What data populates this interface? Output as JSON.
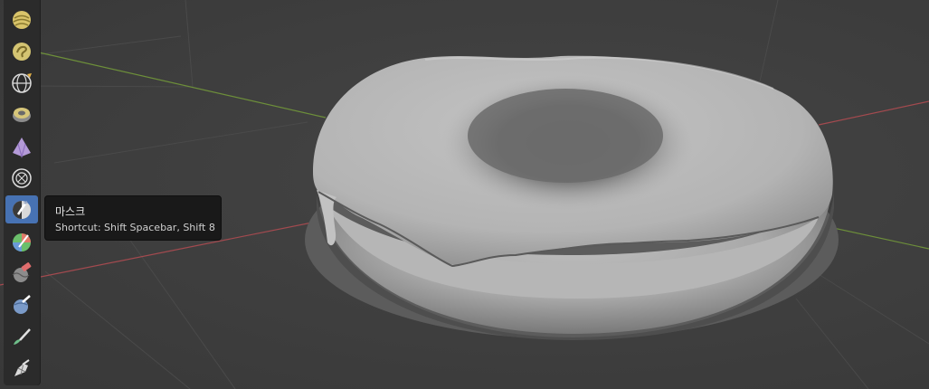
{
  "tooltip": {
    "title": "마스크",
    "shortcut": "Shortcut: Shift Spacebar, Shift 8"
  },
  "toolbar": {
    "active_index": 6,
    "tools": [
      {
        "icon": "blob-brush-icon"
      },
      {
        "icon": "snake-hook-brush-icon"
      },
      {
        "icon": "rotate-brush-icon"
      },
      {
        "icon": "slide-relax-brush-icon"
      },
      {
        "icon": "cloth-brush-icon"
      },
      {
        "icon": "boundary-brush-icon"
      },
      {
        "icon": "mask-brush-icon"
      },
      {
        "icon": "draw-face-sets-icon"
      },
      {
        "icon": "multires-displacement-eraser-icon"
      },
      {
        "icon": "multires-displacement-smear-icon"
      },
      {
        "icon": "paint-brush-icon"
      },
      {
        "icon": "simplify-brush-icon"
      }
    ]
  },
  "colors": {
    "active_tool": "#4772b3",
    "toolbar_bg": "#2b2b2b",
    "x_axis": "#a34a4f",
    "y_axis": "#6d8f3a",
    "tooltip_bg": "#191919"
  }
}
